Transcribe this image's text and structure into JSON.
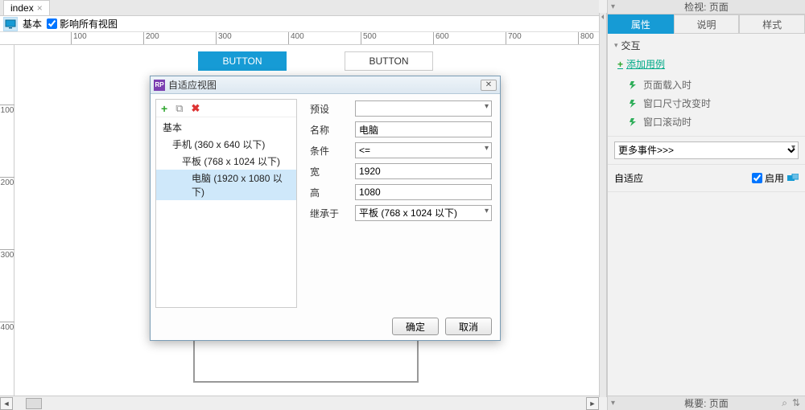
{
  "tab": {
    "name": "index"
  },
  "toolbar": {
    "basic_label": "基本",
    "affect_all_views": "影响所有视图"
  },
  "ruler_h": [
    100,
    200,
    300,
    400,
    500,
    600,
    700,
    800
  ],
  "ruler_v": [
    100,
    200,
    300,
    400
  ],
  "canvas": {
    "button1": "BUTTON",
    "button2": "BUTTON"
  },
  "dialog": {
    "title": "自适应视图",
    "tree": {
      "root": "基本",
      "items": [
        {
          "label": "手机 (360 x 640 以下)"
        },
        {
          "label": "平板 (768 x 1024 以下)"
        },
        {
          "label": "电脑 (1920 x 1080 以下)",
          "selected": true
        }
      ]
    },
    "form": {
      "preset_label": "预设",
      "preset_value": "",
      "name_label": "名称",
      "name_value": "电脑",
      "cond_label": "条件",
      "cond_value": "<=",
      "width_label": "宽",
      "width_value": "1920",
      "height_label": "高",
      "height_value": "1080",
      "inherit_label": "继承于",
      "inherit_value": "平板 (768 x 1024 以下)"
    },
    "ok": "确定",
    "cancel": "取消"
  },
  "right": {
    "inspect_title": "检视: 页面",
    "tabs": {
      "props": "属性",
      "notes": "说明",
      "style": "样式"
    },
    "interaction_title": "交互",
    "add_case": "添加用例",
    "events": [
      "页面载入时",
      "窗口尺寸改变时",
      "窗口滚动时"
    ],
    "more_events": "更多事件>>>",
    "adaptive_label": "自适应",
    "enable_label": "启用",
    "outline_title": "概要: 页面"
  }
}
